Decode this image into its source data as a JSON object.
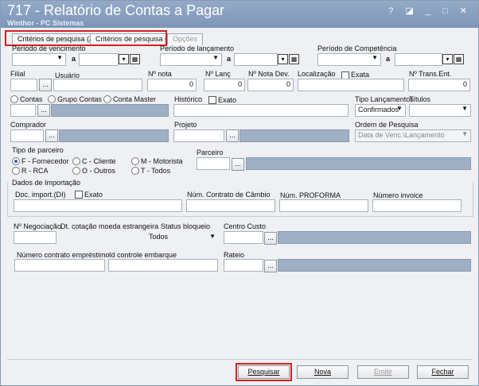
{
  "window": {
    "title": "717 - Relatório de Contas a Pagar",
    "subtitle": "Winthor - PC Sistemas",
    "controls": "? ◪ _ □ ✕"
  },
  "tabs": [
    {
      "label": "Critérios de pesquisa (A)"
    },
    {
      "label": "Critérios de pesquisa (B)"
    },
    {
      "label": "Opções"
    }
  ],
  "periods": {
    "vencimento_label": "Período de vencimento",
    "lancamento_label": "Período de lançamento",
    "competencia_label": "Período de Competência",
    "a": "a"
  },
  "row2": {
    "filial": "Filial",
    "usuario": "Usuário",
    "nota": "Nº nota",
    "nota_value": "0",
    "lanc": "Nº Lanç",
    "lanc_value": "0",
    "nota_dev": "Nº Nota Dev.",
    "nota_dev_value": "0",
    "localizacao": "Localização",
    "exata": "Exata",
    "trans_ent": "Nº Trans.Ent.",
    "trans_ent_value": "0"
  },
  "row3": {
    "contas": "Contas",
    "grupo_contas": "Grupo Contas",
    "conta_master": "Conta Master",
    "historico": "Histórico",
    "exato": "Exato",
    "tipo_lanc": "Tipo Lançamentos",
    "tipo_lanc_value": "Confirmados",
    "titulos": "Títulos"
  },
  "row4": {
    "comprador": "Comprador",
    "projeto": "Projeto",
    "ordem": "Ordem de Pesquisa",
    "ordem_value": "Data de Venc.\\Lançamento"
  },
  "tipo_parceiro": {
    "label": "Tipo de parceiro",
    "f": "F - Fornecedor",
    "c": "C - Cliente",
    "m": "M - Motorista",
    "r": "R - RCA",
    "o": "O - Outros",
    "t": "T - Todos",
    "parceiro": "Parceiro"
  },
  "importacao": {
    "label": "Dados de Importação",
    "doc": "Doc. import.(DI)",
    "exato": "Exato",
    "contrato_cambio": "Núm. Contrato de Câmbio",
    "proforma": "Núm. PROFORMA",
    "invoice": "Número invoice"
  },
  "negociacao": {
    "negociacao": "Nº Negociação",
    "dt_cotacao": "Dt. cotação moeda estrangeira",
    "status": "Status bloqueio",
    "status_value": "Todos",
    "centro_custo": "Centro Custo",
    "contrato_emprestimo": "Número contrato empréstimo",
    "embarque": "Id controle embarque",
    "rateio": "Rateio"
  },
  "buttons": {
    "pesquisar": "Pesquisar",
    "nova": "Nova",
    "emitir": "Emitir",
    "fechar": "Fechar",
    "ellipsis": "..."
  }
}
